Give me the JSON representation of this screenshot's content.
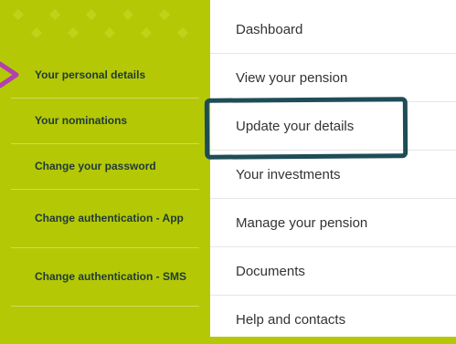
{
  "colors": {
    "accent_green": "#b5c806",
    "text_dark": "#1f3a38",
    "highlight_outline": "#1e4d57",
    "arrow": "#b33fb0"
  },
  "account_menu": {
    "items": [
      {
        "label": "Your personal details",
        "icon": null
      },
      {
        "label": "Your nominations"
      },
      {
        "label": "Change your password"
      },
      {
        "label": "Change authentication - App"
      },
      {
        "label": "Change authentication - SMS"
      }
    ]
  },
  "main_menu": {
    "items": [
      {
        "label": "Dashboard"
      },
      {
        "label": "View your pension"
      },
      {
        "label": "Update your details",
        "highlighted": true
      },
      {
        "label": "Your investments"
      },
      {
        "label": "Manage your pension"
      },
      {
        "label": "Documents"
      },
      {
        "label": "Help and contacts"
      }
    ]
  },
  "icons": {
    "arrow": "arrow-right-icon"
  }
}
